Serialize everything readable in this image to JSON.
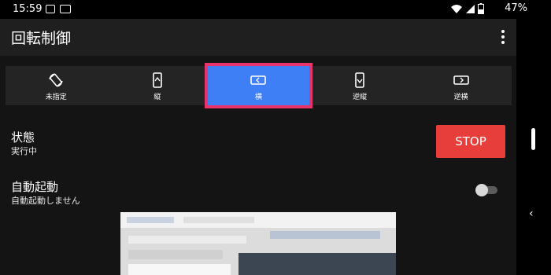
{
  "status_bar": {
    "time": "15:59",
    "battery": "47%",
    "icons": [
      "image-icon",
      "cast-icon",
      "wifi-icon",
      "signal-icon",
      "battery-icon"
    ]
  },
  "app_bar": {
    "title": "回転制御",
    "menu_icon": "more-vert-icon"
  },
  "modes": [
    {
      "label": "未指定",
      "icon": "auto-rotate-icon",
      "active": false
    },
    {
      "label": "縦",
      "icon": "portrait-icon",
      "active": false
    },
    {
      "label": "横",
      "icon": "landscape-icon",
      "active": true
    },
    {
      "label": "逆縦",
      "icon": "reverse-portrait-icon",
      "active": false
    },
    {
      "label": "逆横",
      "icon": "reverse-landscape-icon",
      "active": false
    }
  ],
  "state": {
    "title": "状態",
    "value": "実行中",
    "stop_label": "STOP"
  },
  "autostart": {
    "title": "自動起動",
    "subtitle": "自動起動しません",
    "enabled": false
  },
  "colors": {
    "accent": "#3f7ff5",
    "highlight": "#e8336b",
    "stop": "#e73e3b",
    "background": "#141414"
  }
}
